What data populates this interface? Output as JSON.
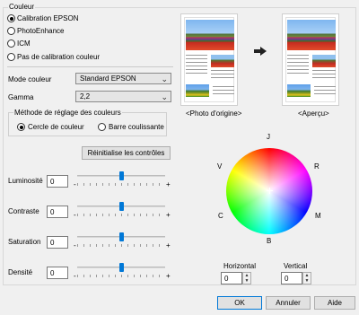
{
  "couleur": {
    "title": "Couleur",
    "options": [
      {
        "label": "Calibration EPSON",
        "checked": true
      },
      {
        "label": "PhotoEnhance",
        "checked": false
      },
      {
        "label": "ICM",
        "checked": false
      },
      {
        "label": "Pas de calibration couleur",
        "checked": false
      }
    ]
  },
  "mode_couleur": {
    "label": "Mode couleur",
    "value": "Standard EPSON"
  },
  "gamma": {
    "label": "Gamma",
    "value": "2,2"
  },
  "methode": {
    "title": "Méthode de réglage des couleurs",
    "options": [
      {
        "label": "Cercle de couleur",
        "checked": true
      },
      {
        "label": "Barre coulissante",
        "checked": false
      }
    ]
  },
  "reset_button": "Réinitialise les contrôles",
  "sliders": [
    {
      "label": "Luminosité",
      "value": "0",
      "minus": "-",
      "plus": "+",
      "level": 0.5
    },
    {
      "label": "Contraste",
      "value": "0",
      "minus": "-",
      "plus": "+",
      "level": 0.5
    },
    {
      "label": "Saturation",
      "value": "0",
      "minus": "-",
      "plus": "+",
      "level": 0.5
    },
    {
      "label": "Densité",
      "value": "0",
      "minus": "-",
      "plus": "+",
      "level": 0.5
    }
  ],
  "preview": {
    "original_label": "<Photo d'origine>",
    "apercu_label": "<Aperçu>",
    "arrow_icon": "right-arrow-icon"
  },
  "wheel": {
    "J": "J",
    "R": "R",
    "M": "M",
    "B": "B",
    "C": "C",
    "V": "V"
  },
  "horizontal": {
    "label": "Horizontal",
    "value": "0"
  },
  "vertical": {
    "label": "Vertical",
    "value": "0"
  },
  "footer": {
    "ok": "OK",
    "annuler": "Annuler",
    "aide": "Aide"
  }
}
